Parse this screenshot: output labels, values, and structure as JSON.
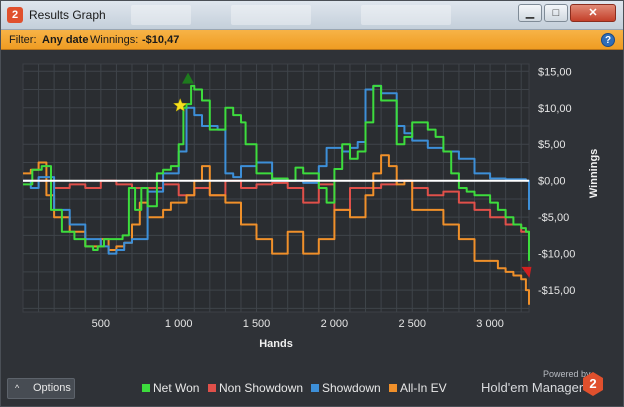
{
  "window": {
    "title": "Results Graph",
    "logo_glyph": "2"
  },
  "filter": {
    "prefix": "Filter:",
    "date": "Any date",
    "winnings_label": "Winnings:",
    "winnings_value": "-$10,47"
  },
  "options": {
    "label": "Options"
  },
  "branding": {
    "powered_by": "Powered by",
    "name": "Hold'em Manager",
    "logo_glyph": "2"
  },
  "colors": {
    "net_won": "#3ddc3d",
    "non_showdown": "#e0504a",
    "showdown": "#3d8fd8",
    "all_in_ev": "#f0902a",
    "zero_line": "#ffffff",
    "accent": "#f0a030"
  },
  "chart_data": {
    "type": "line",
    "xlabel": "Hands",
    "ylabel": "Winnings",
    "xlim": [
      0,
      3250
    ],
    "ylim": [
      -18,
      16
    ],
    "x_ticks": [
      500,
      1000,
      1500,
      2000,
      2500,
      3000
    ],
    "x_tick_labels": [
      "500",
      "1 000",
      "1 500",
      "2 000",
      "2 500",
      "3 000"
    ],
    "y_ticks": [
      15,
      10,
      5,
      0,
      -5,
      -10,
      -15
    ],
    "y_tick_labels": [
      "$15,00",
      "$10,00",
      "$5,00",
      "$0,00",
      "-$5,00",
      "-$10,00",
      "-$15,00"
    ],
    "grid": true,
    "legend_position": "bottom",
    "series": [
      {
        "key": "net_won",
        "name": "Net Won",
        "x": [
          0,
          60,
          120,
          180,
          250,
          330,
          400,
          450,
          480,
          520,
          600,
          640,
          680,
          720,
          760,
          800,
          860,
          900,
          950,
          1000,
          1030,
          1050,
          1080,
          1100,
          1150,
          1200,
          1250,
          1300,
          1350,
          1400,
          1430,
          1500,
          1550,
          1600,
          1650,
          1700,
          1750,
          1800,
          1900,
          1950,
          2000,
          2050,
          2100,
          2150,
          2200,
          2250,
          2300,
          2350,
          2400,
          2450,
          2500,
          2550,
          2600,
          2650,
          2700,
          2750,
          2800,
          2850,
          2900,
          2950,
          3000,
          3050,
          3100,
          3150,
          3200,
          3230,
          3250
        ],
        "values": [
          -0.5,
          1.5,
          2,
          -4,
          -7,
          -8,
          -9,
          -9.5,
          -9,
          -8,
          -8,
          -7.5,
          -1,
          -4,
          -1,
          -3.5,
          1,
          1.5,
          2,
          5,
          10,
          10.5,
          13,
          12.5,
          11,
          7,
          7,
          10,
          9,
          8,
          5,
          1,
          1,
          0.3,
          0.3,
          0,
          1.8,
          1,
          -1,
          -3,
          1.6,
          5,
          3,
          4,
          8,
          13,
          11,
          11,
          5,
          6,
          8,
          8,
          7,
          6,
          4,
          1,
          -1,
          -1.5,
          -2,
          -2,
          -3,
          -4,
          -5,
          -6,
          -6.5,
          -7,
          -11
        ]
      },
      {
        "key": "non_showdown",
        "name": "Non Showdown",
        "x": [
          0,
          100,
          200,
          300,
          400,
          500,
          600,
          700,
          800,
          900,
          1000,
          1100,
          1200,
          1300,
          1400,
          1500,
          1600,
          1700,
          1800,
          1900,
          2000,
          2100,
          2200,
          2300,
          2400,
          2500,
          2600,
          2700,
          2800,
          2900,
          3000,
          3100,
          3200,
          3250
        ],
        "values": [
          0,
          0,
          -1,
          -0.5,
          -1,
          0,
          -0.5,
          -1,
          -1,
          -0.5,
          -2,
          -1,
          -2,
          0,
          -1,
          -0.5,
          -0.3,
          -1,
          -3,
          -0.5,
          -4,
          -1,
          -1,
          -0.5,
          0,
          -1,
          -2,
          -1.5,
          -3,
          -4,
          -5,
          -6,
          -7,
          -9
        ]
      },
      {
        "key": "showdown",
        "name": "Showdown",
        "x": [
          0,
          50,
          100,
          200,
          300,
          400,
          500,
          550,
          600,
          650,
          700,
          800,
          900,
          1000,
          1050,
          1100,
          1150,
          1200,
          1250,
          1300,
          1350,
          1400,
          1500,
          1600,
          1700,
          1800,
          1900,
          1950,
          2000,
          2050,
          2100,
          2150,
          2200,
          2250,
          2300,
          2400,
          2450,
          2500,
          2600,
          2700,
          2800,
          2900,
          3000,
          3100,
          3150,
          3200,
          3230,
          3250
        ],
        "values": [
          0,
          -1,
          0.5,
          -4,
          -6,
          -8,
          -9,
          -10,
          -9.5,
          -8.5,
          -8,
          -1.5,
          1,
          4,
          10,
          9,
          7.5,
          7.5,
          7,
          1,
          0.5,
          2,
          2.5,
          0,
          0,
          -0.3,
          2,
          4.5,
          4.5,
          4,
          4.5,
          5.3,
          12.5,
          13,
          12,
          7.5,
          6.5,
          5.5,
          4.5,
          4,
          3,
          1,
          0.3,
          0.2,
          0.2,
          0.2,
          0,
          -4
        ]
      },
      {
        "key": "all_in_ev",
        "name": "All-In EV",
        "x": [
          0,
          50,
          100,
          150,
          200,
          300,
          400,
          500,
          550,
          600,
          650,
          700,
          750,
          800,
          850,
          900,
          950,
          1000,
          1050,
          1100,
          1150,
          1200,
          1250,
          1300,
          1400,
          1500,
          1600,
          1700,
          1800,
          1900,
          2000,
          2100,
          2200,
          2250,
          2300,
          2350,
          2400,
          2450,
          2500,
          2600,
          2700,
          2800,
          2900,
          3000,
          3050,
          3100,
          3150,
          3200,
          3230,
          3250
        ],
        "values": [
          1,
          1.5,
          2.5,
          -2,
          -5,
          -7,
          -9,
          -8,
          -9.5,
          -9,
          -8.5,
          -6,
          -3,
          -5,
          -5,
          -4,
          -3,
          -3,
          -2,
          0,
          2,
          -2,
          -2,
          -3,
          -6,
          -8,
          -10,
          -7,
          -10,
          -8,
          -4,
          -5,
          -2,
          1,
          3.5,
          2,
          -0.5,
          0,
          -4,
          -4,
          -6,
          -8,
          -11,
          -11,
          -12,
          -12.5,
          -13,
          -13.5,
          -15,
          -17
        ]
      }
    ],
    "markers": [
      {
        "kind": "star",
        "x": 1010,
        "y": 10.3,
        "color": "#f7e020"
      },
      {
        "kind": "up-triangle",
        "x": 1060,
        "y": 14,
        "color": "#1e7a1e"
      },
      {
        "kind": "down-triangle",
        "x": 3240,
        "y": -12.5,
        "color": "#d02020"
      }
    ]
  }
}
